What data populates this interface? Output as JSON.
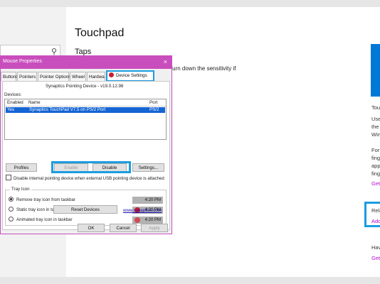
{
  "settings": {
    "page_title": "Touchpad",
    "section_title": "Taps",
    "taps_description": "t. Turn down the sensitivity if",
    "right_panel": {
      "touchpad_heading": "Tou",
      "touchpad_lines": [
        "Use",
        "the",
        "Win"
      ],
      "finger_lines": [
        "For",
        "fing",
        "app",
        "fing"
      ],
      "get_link_1": "Get",
      "related_heading": "Rela",
      "additional_link": "Add",
      "have_text": "Hav",
      "get_link_2": "Get"
    }
  },
  "dialog": {
    "title": "Mouse Properties",
    "close_label": "×",
    "tabs": [
      "Buttons",
      "Pointers",
      "Pointer Options",
      "Wheel",
      "Hardware",
      "Device Settings"
    ],
    "device_version": "Synaptics Pointing Device - v19.0.12.98",
    "devices_label": "Devices:",
    "columns": [
      "Enabled",
      "Name",
      "Port"
    ],
    "rows": [
      {
        "enabled": "Yes",
        "name": "Synaptics TouchPad V7.5 on PS/2 Port",
        "port": "PS/2"
      }
    ],
    "buttons": {
      "profiles": "Profiles",
      "enable": "Enable",
      "disable": "Disable",
      "settings": "Settings...",
      "reset": "Reset Devices",
      "ok": "OK",
      "cancel": "Cancel",
      "apply": "Apply"
    },
    "disable_internal_label": "Disable internal pointing device when external USB pointing device is attached",
    "tray": {
      "legend": "Tray Icon",
      "options": [
        {
          "label": "Remove tray icon from taskbar",
          "selected": true,
          "time": "4:20 PM"
        },
        {
          "label": "Static tray icon in taskbar",
          "selected": false,
          "time": "4:20 PM"
        },
        {
          "label": "Animated tray icon in taskbar",
          "selected": false,
          "time": "4:20 PM"
        }
      ]
    },
    "website": "www.synaptics.com"
  },
  "colors": {
    "titlebar": "#c94ebd",
    "highlight": "#1b9ce0",
    "selection": "#1565d4",
    "link": "#b30ad6"
  }
}
